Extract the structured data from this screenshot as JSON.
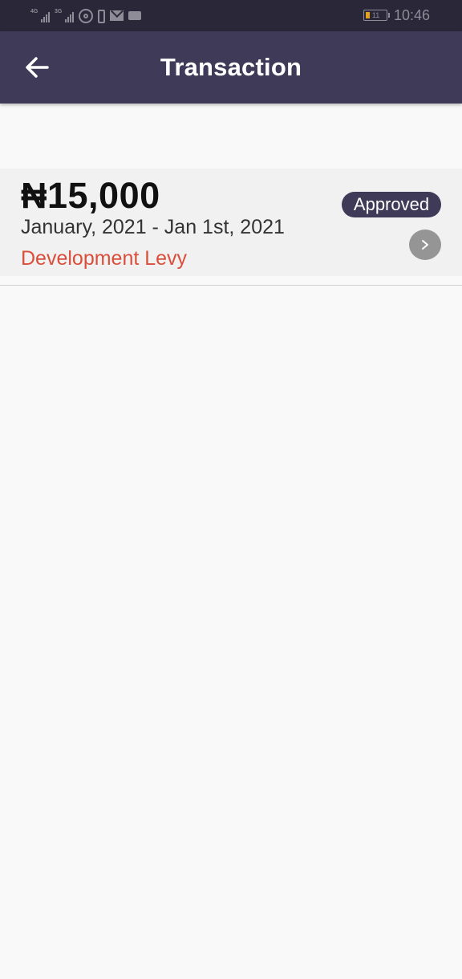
{
  "status_bar": {
    "sim1_network": "4G",
    "sim2_network": "3G",
    "battery_level": "11",
    "time": "10:46"
  },
  "app_bar": {
    "title": "Transaction",
    "back_icon": "arrow-left-icon"
  },
  "transactions": [
    {
      "amount": "₦15,000",
      "period": "January, 2021 - Jan 1st, 2021",
      "category": "Development Levy",
      "status": "Approved",
      "action_icon": "chevron-right-icon"
    }
  ],
  "colors": {
    "app_bar": "#3f3a57",
    "status_bar": "#2a2738",
    "badge": "#3f3a57",
    "category_text": "#d94f3c",
    "card_background": "#f1f1f1",
    "page_background": "#f9f9f9",
    "battery_fill": "#e3a21a"
  }
}
